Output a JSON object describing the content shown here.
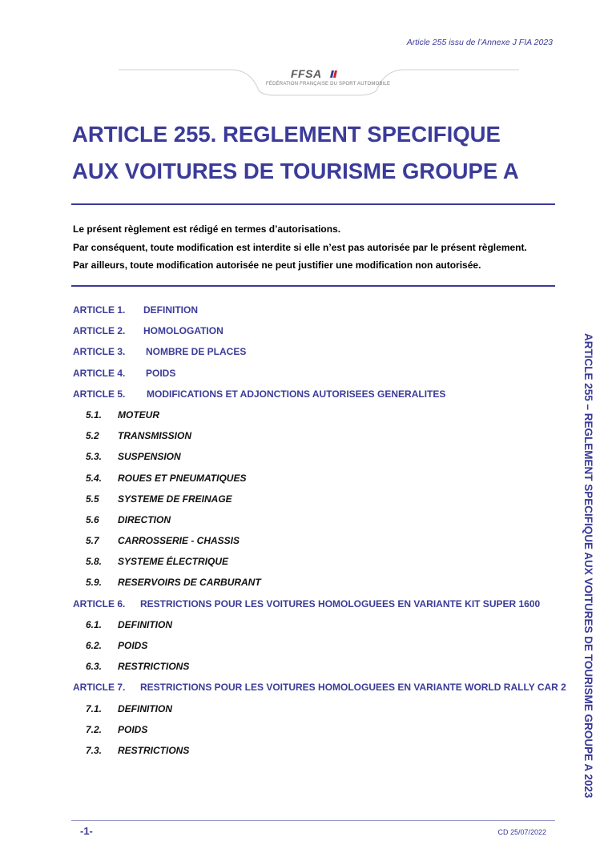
{
  "header_note": "Article 255 issu de l’Annexe J FIA 2023",
  "logo": {
    "wordmark": "FFSA",
    "subtitle": "FÉDÉRATION FRANÇAISE DU SPORT AUTOMOBILE"
  },
  "title": {
    "line1": "ARTICLE 255. REGLEMENT SPECIFIQUE",
    "line2": "AUX VOITURES DE TOURISME GROUPE A"
  },
  "intro": [
    "Le présent règlement est rédigé en termes d’autorisations.",
    "Par conséquent, toute modification est interdite si elle n’est pas autorisée par le présent règlement.",
    "Par ailleurs, toute modification autorisée ne peut justifier une modification non autorisée."
  ],
  "toc": [
    {
      "kind": "article",
      "num": "ARTICLE 1.",
      "label": "DEFINITION"
    },
    {
      "kind": "article",
      "num": "ARTICLE 2.",
      "label": "HOMOLOGATION"
    },
    {
      "kind": "article",
      "num": "ARTICLE 3.",
      "label": "NOMBRE DE PLACES"
    },
    {
      "kind": "article",
      "num": "ARTICLE 4.",
      "label": "POIDS"
    },
    {
      "kind": "article",
      "num": "ARTICLE 5.",
      "label": "MODIFICATIONS ET ADJONCTIONS AUTORISEES GENERALITES"
    },
    {
      "kind": "sub",
      "num": "5.1.",
      "label": "MOTEUR"
    },
    {
      "kind": "sub",
      "num": "5.2",
      "label": "TRANSMISSION"
    },
    {
      "kind": "sub",
      "num": "5.3.",
      "label": "SUSPENSION"
    },
    {
      "kind": "sub",
      "num": "5.4.",
      "label": "ROUES ET PNEUMATIQUES"
    },
    {
      "kind": "sub",
      "num": "5.5",
      "label": "SYSTEME DE FREINAGE"
    },
    {
      "kind": "sub",
      "num": "5.6",
      "label": "DIRECTION"
    },
    {
      "kind": "sub",
      "num": "5.7",
      "label": "CARROSSERIE - CHASSIS"
    },
    {
      "kind": "sub",
      "num": "5.8.",
      "label": "SYSTEME ÉLECTRIQUE"
    },
    {
      "kind": "sub",
      "num": "5.9.",
      "label": "RESERVOIRS DE CARBURANT"
    },
    {
      "kind": "article",
      "num": "ARTICLE 6.",
      "label": "RESTRICTIONS POUR LES VOITURES HOMOLOGUEES EN VARIANTE KIT SUPER 1600"
    },
    {
      "kind": "sub",
      "num": "6.1.",
      "label": "DEFINITION"
    },
    {
      "kind": "sub",
      "num": "6.2.",
      "label": "POIDS"
    },
    {
      "kind": "sub",
      "num": "6.3.",
      "label": "RESTRICTIONS"
    },
    {
      "kind": "article",
      "num": "ARTICLE 7.",
      "label": "RESTRICTIONS POUR LES VOITURES HOMOLOGUEES EN VARIANTE WORLD RALLY CAR 2"
    },
    {
      "kind": "sub",
      "num": "7.1.",
      "label": "DEFINITION"
    },
    {
      "kind": "sub",
      "num": "7.2.",
      "label": "POIDS"
    },
    {
      "kind": "sub",
      "num": "7.3.",
      "label": "RESTRICTIONS"
    }
  ],
  "side_text": "ARTICLE 255 – REGLEMENT SPECIFIQUE AUX VOITURES DE TOURISME GROUPE A 2023",
  "footer": {
    "page": "-1-",
    "date": "CD 25/07/2022"
  },
  "colors": {
    "accent": "#3b3b9a",
    "logo_red": "#d2232a"
  }
}
